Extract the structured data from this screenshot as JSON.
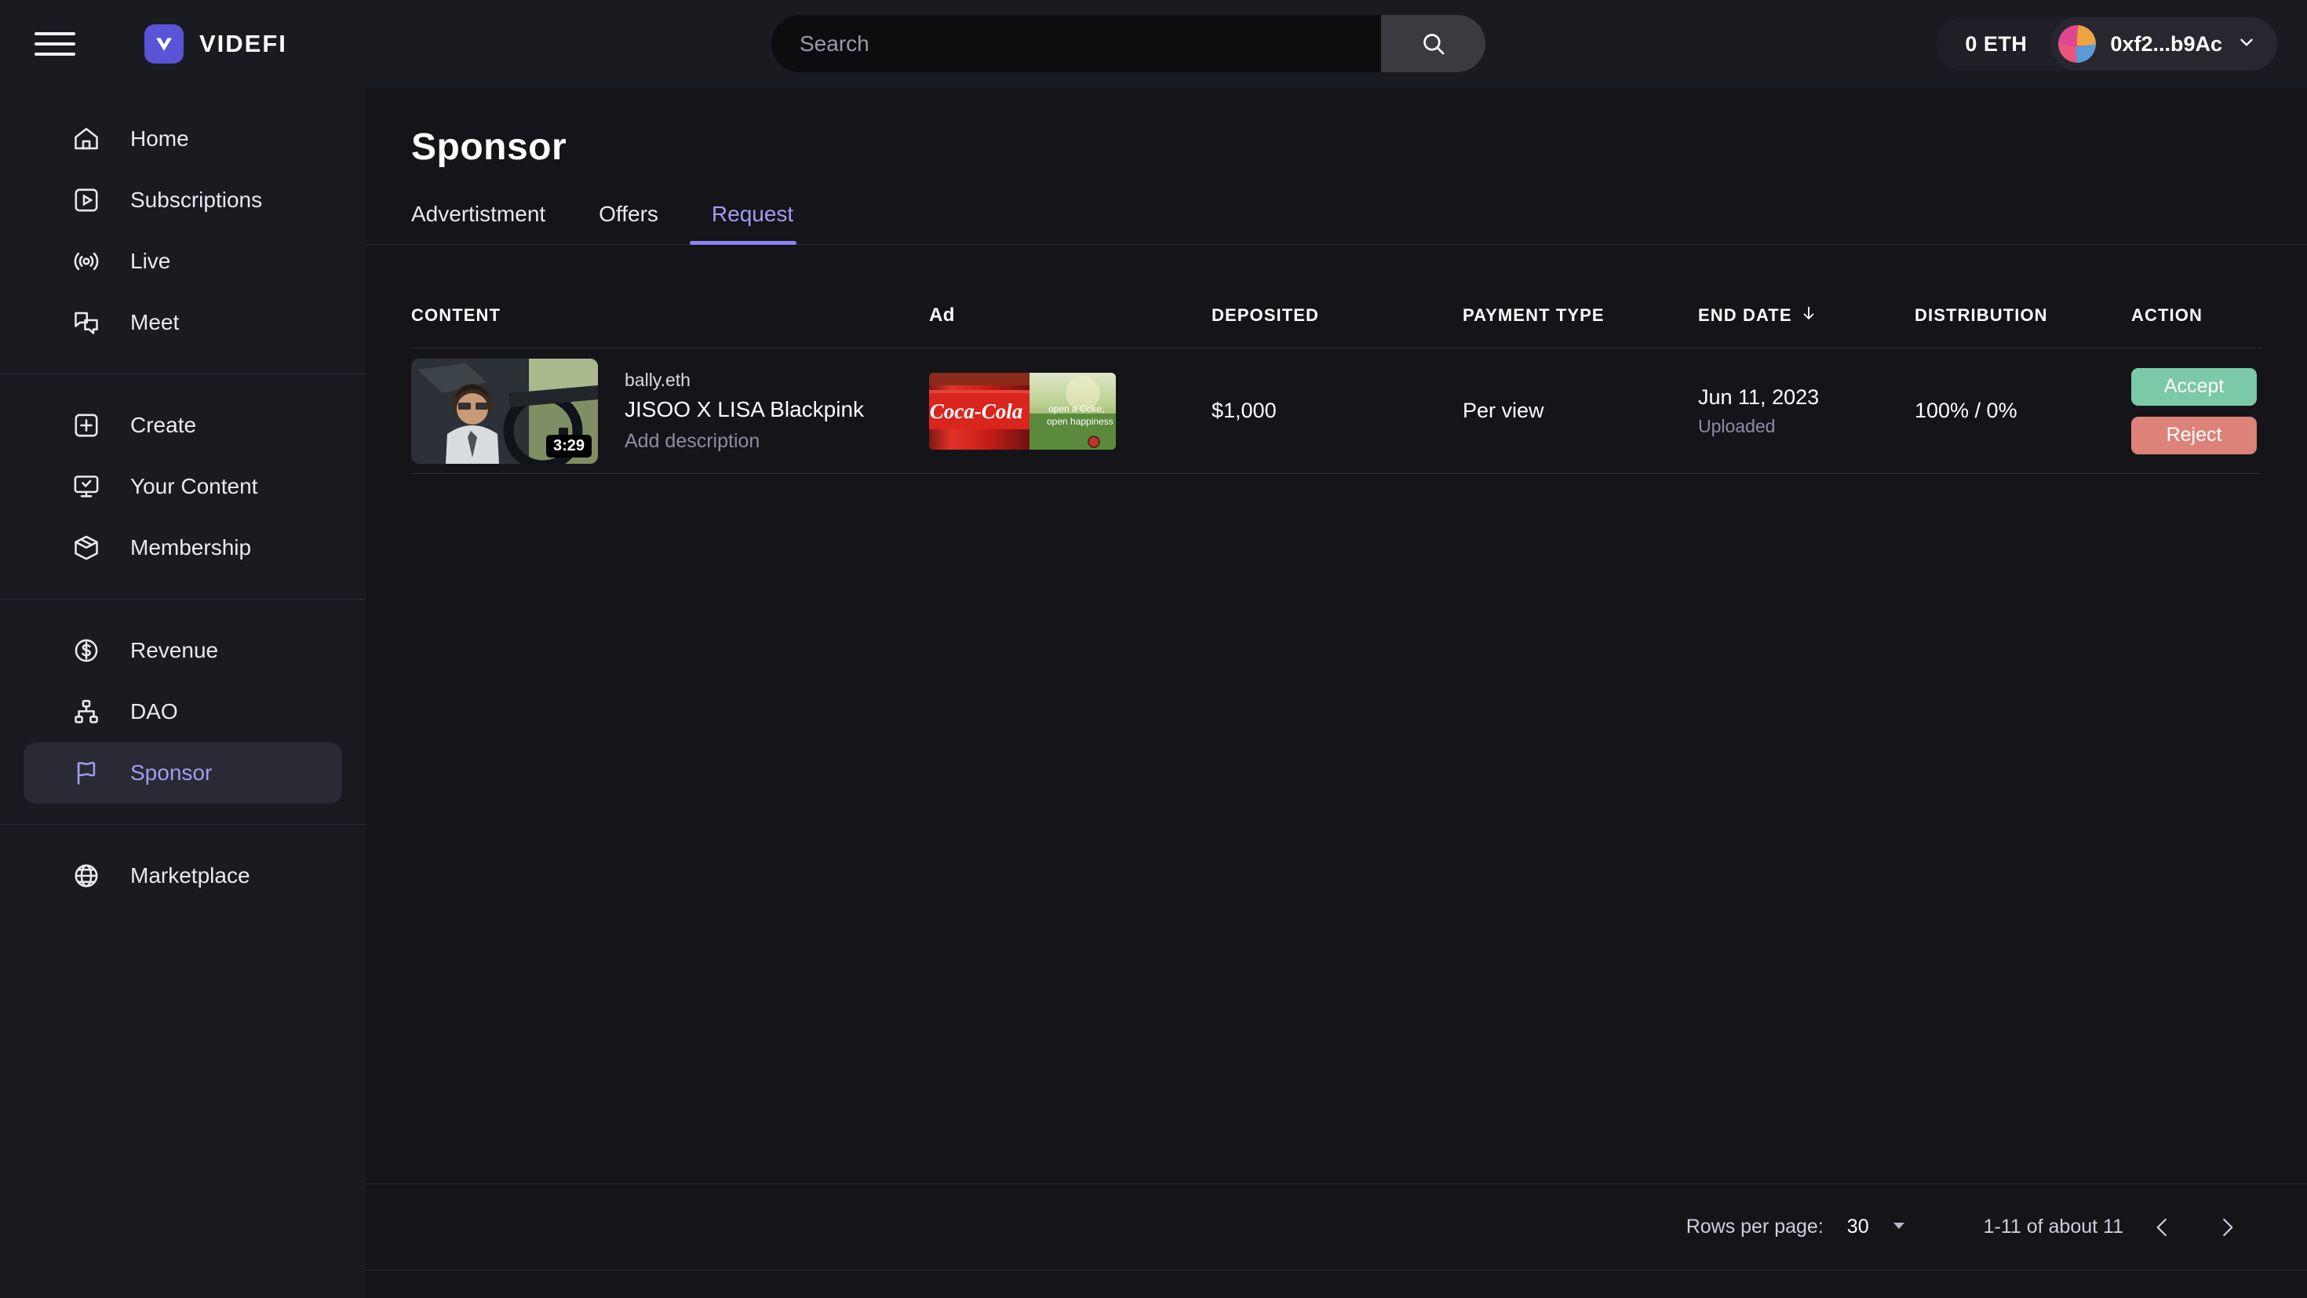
{
  "header": {
    "menu_icon": "hamburger-icon",
    "brand": "VIDEFI",
    "search": {
      "value": "",
      "placeholder": "Search",
      "icon": "search-icon"
    },
    "eth_balance": "0 ETH",
    "wallet_address": "0xf2...b9Ac",
    "wallet_chevron": "chevron-down-icon"
  },
  "sidebar": {
    "groups": [
      {
        "items": [
          {
            "label": "Home",
            "icon": "home-icon",
            "active": false
          },
          {
            "label": "Subscriptions",
            "icon": "play-square-icon",
            "active": false
          },
          {
            "label": "Live",
            "icon": "broadcast-icon",
            "active": false
          },
          {
            "label": "Meet",
            "icon": "chat-bubbles-icon",
            "active": false
          }
        ]
      },
      {
        "items": [
          {
            "label": "Create",
            "icon": "plus-square-icon",
            "active": false
          },
          {
            "label": "Your Content",
            "icon": "monitor-check-icon",
            "active": false
          },
          {
            "label": "Membership",
            "icon": "box-icon",
            "active": false
          }
        ]
      },
      {
        "items": [
          {
            "label": "Revenue",
            "icon": "dollar-circle-icon",
            "active": false
          },
          {
            "label": "DAO",
            "icon": "hierarchy-icon",
            "active": false
          },
          {
            "label": "Sponsor",
            "icon": "flag-icon",
            "active": true
          }
        ]
      },
      {
        "items": [
          {
            "label": "Marketplace",
            "icon": "globe-icon",
            "active": false
          }
        ]
      }
    ]
  },
  "main": {
    "title": "Sponsor",
    "tabs": [
      {
        "label": "Advertistment",
        "active": false
      },
      {
        "label": "Offers",
        "active": false
      },
      {
        "label": "Request",
        "active": true
      }
    ],
    "table": {
      "columns": [
        {
          "key": "content",
          "label": "CONTENT"
        },
        {
          "key": "ad",
          "label": "Ad"
        },
        {
          "key": "deposited",
          "label": "DEPOSITED"
        },
        {
          "key": "payment_type",
          "label": "PAYMENT TYPE"
        },
        {
          "key": "end_date",
          "label": "END DATE",
          "sort_icon": "arrow-down-icon"
        },
        {
          "key": "distribution",
          "label": "DISTRIBUTION"
        },
        {
          "key": "action",
          "label": "ACTION"
        }
      ],
      "rows": [
        {
          "channel": "bally.eth",
          "title": "JISOO X LISA Blackpink",
          "description": "Add description",
          "duration": "3:29",
          "ad_alt": "Coca-Cola open happiness advertisement",
          "ad_caption_line1": "open a Coke,",
          "ad_caption_line2": "open happiness",
          "ad_brand": "Coca-Cola",
          "deposited": "$1,000",
          "payment_type": "Per view",
          "end_date": "Jun 11, 2023",
          "end_date_status": "Uploaded",
          "distribution": "100% / 0%",
          "accept_label": "Accept",
          "reject_label": "Reject"
        }
      ]
    }
  },
  "footer": {
    "rows_per_page_label": "Rows per page:",
    "rows_per_page_value": "30",
    "dropdown_icon": "caret-down-icon",
    "range_text": "1-11 of about 11",
    "prev_icon": "chevron-left-icon",
    "next_icon": "chevron-right-icon"
  },
  "colors": {
    "accent": "#8b83ef",
    "accent_text": "#a29cf0",
    "accept": "#7bc9a6",
    "reject": "#dc8279",
    "brand_mark": "#5a55d6",
    "bg_main": "#141419",
    "bg_chrome": "#1a1a21"
  }
}
